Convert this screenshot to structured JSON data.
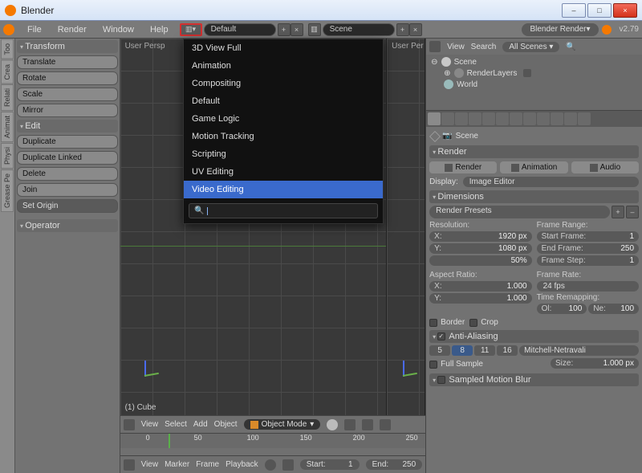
{
  "window": {
    "title": "Blender"
  },
  "win_buttons": {
    "min": "–",
    "max": "□",
    "close": "×"
  },
  "topmenu": {
    "file": "File",
    "render": "Render",
    "window": "Window",
    "help": "Help"
  },
  "layout_field": "Default",
  "scene_field": "Scene",
  "engine": "Blender Render",
  "version": "v2.79",
  "left_tabs": [
    "Too",
    "Crea",
    "Relati",
    "Animat",
    "Physi",
    "Grease Pe"
  ],
  "toolshelf": {
    "transform_head": "Transform",
    "translate": "Translate",
    "rotate": "Rotate",
    "scale": "Scale",
    "mirror": "Mirror",
    "edit_head": "Edit",
    "duplicate": "Duplicate",
    "dup_linked": "Duplicate Linked",
    "delete": "Delete",
    "join": "Join",
    "set_origin": "Set Origin",
    "operator_head": "Operator"
  },
  "viewport": {
    "persp": "User Persp",
    "selection": "(1) Cube",
    "header": {
      "view": "View",
      "select": "Select",
      "add": "Add",
      "object": "Object",
      "mode": "Object Mode"
    }
  },
  "timeline": {
    "ticks": [
      "0",
      "50",
      "100",
      "150",
      "200",
      "250"
    ],
    "header": {
      "view": "View",
      "marker": "Marker",
      "frame": "Frame",
      "playback": "Playback",
      "start_label": "Start:",
      "start_val": "1",
      "end_label": "End:",
      "end_val": "250"
    }
  },
  "outliner": {
    "view": "View",
    "search": "Search",
    "filter": "All Scenes",
    "scene": "Scene",
    "renderlayers": "RenderLayers",
    "world": "World"
  },
  "props": {
    "crumb_scene": "Scene",
    "render_head": "Render",
    "btn_render": "Render",
    "btn_anim": "Animation",
    "btn_audio": "Audio",
    "display_label": "Display:",
    "display_val": "Image Editor",
    "dims_head": "Dimensions",
    "presets": "Render Presets",
    "res_head": "Resolution:",
    "res_x_label": "X:",
    "res_x": "1920 px",
    "res_y_label": "Y:",
    "res_y": "1080 px",
    "res_pct": "50%",
    "range_head": "Frame Range:",
    "start_l": "Start Frame:",
    "start_v": "1",
    "end_l": "End Frame:",
    "end_v": "250",
    "step_l": "Frame Step:",
    "step_v": "1",
    "aspect_head": "Aspect Ratio:",
    "ax_l": "X:",
    "ax_v": "1.000",
    "ay_l": "Y:",
    "ay_v": "1.000",
    "rate_head": "Frame Rate:",
    "rate_v": "24 fps",
    "remap_head": "Time Remapping:",
    "old_l": "Ol:",
    "old_v": "100",
    "new_l": "Ne:",
    "new_v": "100",
    "border": "Border",
    "crop": "Crop",
    "aa_head": "Anti-Aliasing",
    "aa": {
      "s5": "5",
      "s8": "8",
      "s11": "11",
      "s16": "16"
    },
    "aa_filter": "Mitchell-Netravali",
    "full_sample": "Full Sample",
    "size_l": "Size:",
    "size_v": "1.000 px",
    "smb_head": "Sampled Motion Blur"
  },
  "dropdown": {
    "items": [
      "3D View Full",
      "Animation",
      "Compositing",
      "Default",
      "Game Logic",
      "Motion Tracking",
      "Scripting",
      "UV Editing",
      "Video Editing"
    ],
    "highlight_index": 8,
    "search_placeholder": ""
  }
}
